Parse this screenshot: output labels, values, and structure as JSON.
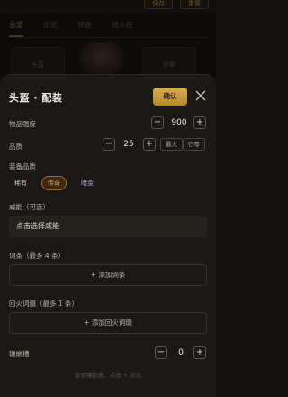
{
  "background": {
    "top_buttons": [
      "保存",
      "重置"
    ],
    "tabs": [
      "总览",
      "技能",
      "装备",
      "随从技"
    ],
    "cards": [
      "头盔",
      "护甲"
    ]
  },
  "sheet": {
    "title": "头盔 · 配装",
    "confirm_label": "确认",
    "item_strength": {
      "label": "物品强度",
      "value": "900",
      "minus": "−",
      "plus": "+"
    },
    "quality": {
      "label": "品质",
      "value": "25",
      "minus": "−",
      "plus": "+",
      "max_label": "最大",
      "reset_label": "归零"
    },
    "rarity": {
      "label": "装备品质",
      "options": [
        "稀有",
        "传奇",
        "暗金"
      ],
      "selected": "传奇"
    },
    "power": {
      "label": "威能（可选）",
      "button": "点击选择威能"
    },
    "affixes": {
      "label": "词条（最多 4 条）",
      "add": "+ 添加词条"
    },
    "tempered": {
      "label": "回火词缀（最多 1 条）",
      "add": "+ 添加回火词缀"
    },
    "sockets": {
      "label": "镶嵌槽",
      "value": "0",
      "minus": "−",
      "plus": "+",
      "hint": "暂无镶嵌槽，点击 + 添加"
    }
  },
  "colors": {
    "accent": "#d2a846",
    "selected_pill_bg": "#3a2a16",
    "selected_pill_text": "#e0a050",
    "mythic_text": "#b8a0e0"
  }
}
